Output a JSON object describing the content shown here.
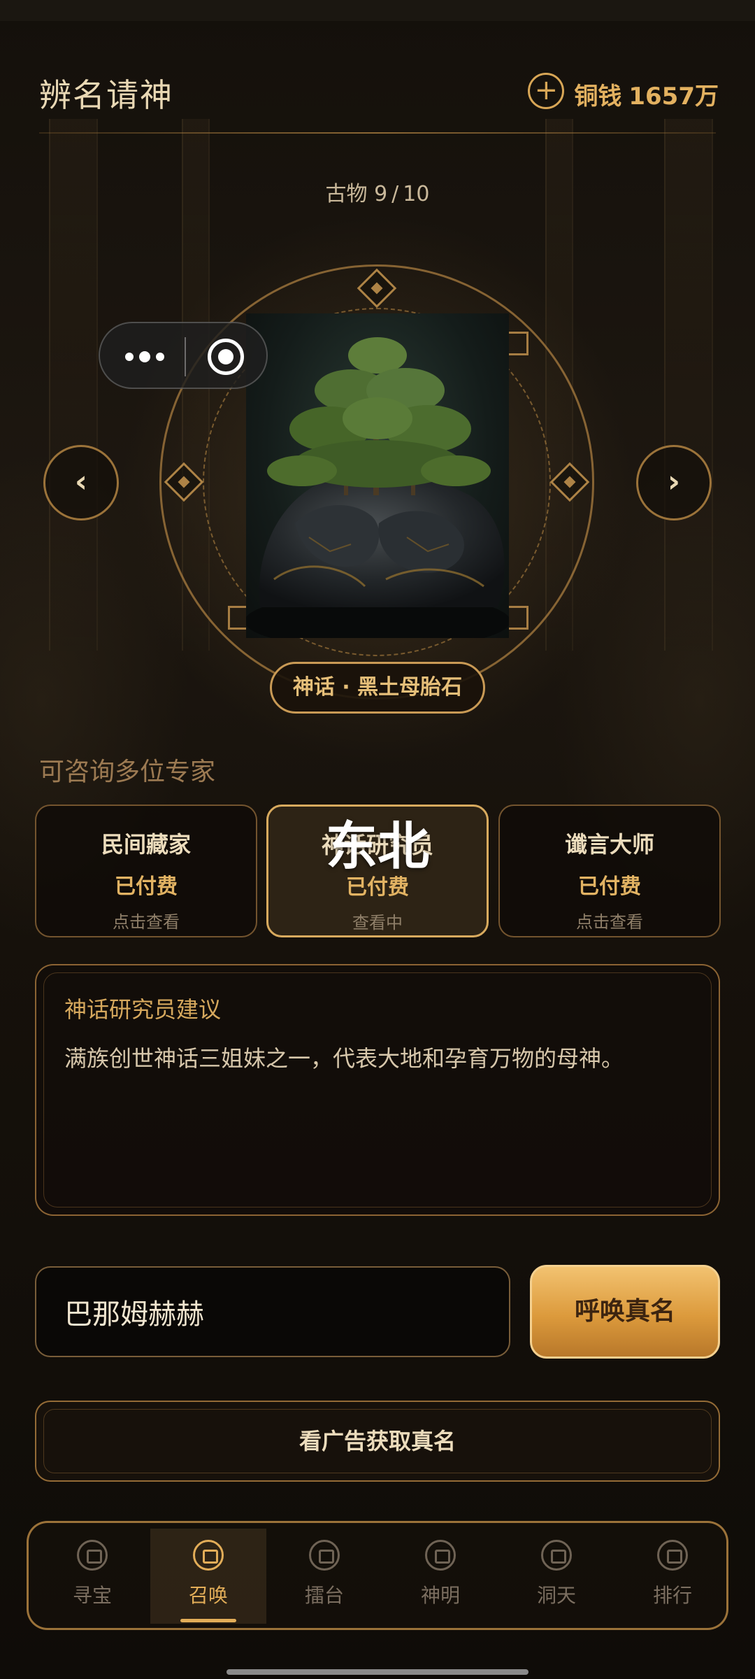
{
  "header": {
    "title": "辨名请神",
    "add_coin_icon": "plus-circle-icon",
    "coin_label": "铜钱",
    "coin_amount": "1657万"
  },
  "artifact": {
    "index": "9",
    "total": "10",
    "counter_prefix": "古物",
    "counter_separator": "/",
    "name": "神话 · 黑土母胎石",
    "image": "moss-covered-black-stone-with-trees"
  },
  "miniprogram_capsule": {
    "more_icon": "more-dots-icon",
    "close_icon": "target-circle-icon"
  },
  "nav": {
    "prev": "‹",
    "next": "›"
  },
  "experts": {
    "heading": "可咨询多位专家",
    "region_overlay": "东北",
    "cards": [
      {
        "name": "民间藏家",
        "status": "已付费",
        "action": "点击查看",
        "active": false
      },
      {
        "name": "神话研究员",
        "status": "已付费",
        "action": "查看中",
        "active": true
      },
      {
        "name": "谶言大师",
        "status": "已付费",
        "action": "点击查看",
        "active": false
      }
    ]
  },
  "advice": {
    "title": "神话研究员建议",
    "text": "满族创世神话三姐妹之一，代表大地和孕育万物的母神。"
  },
  "answer": {
    "value": "巴那姆赫赫",
    "submit_label": "呼唤真名"
  },
  "ad_button": {
    "label": "看广告获取真名"
  },
  "tabs": [
    {
      "label": "寻宝",
      "icon": "treasure-icon",
      "active": false
    },
    {
      "label": "召唤",
      "icon": "summon-icon",
      "active": true
    },
    {
      "label": "擂台",
      "icon": "arena-icon",
      "active": false
    },
    {
      "label": "神明",
      "icon": "deity-icon",
      "active": false
    },
    {
      "label": "洞天",
      "icon": "cave-icon",
      "active": false
    },
    {
      "label": "排行",
      "icon": "ranking-icon",
      "active": false
    }
  ],
  "colors": {
    "accent_gold": "#e2ad58",
    "border_gold": "#c99a55",
    "background": "#14100b",
    "summon_button": "#dc9a3c"
  }
}
